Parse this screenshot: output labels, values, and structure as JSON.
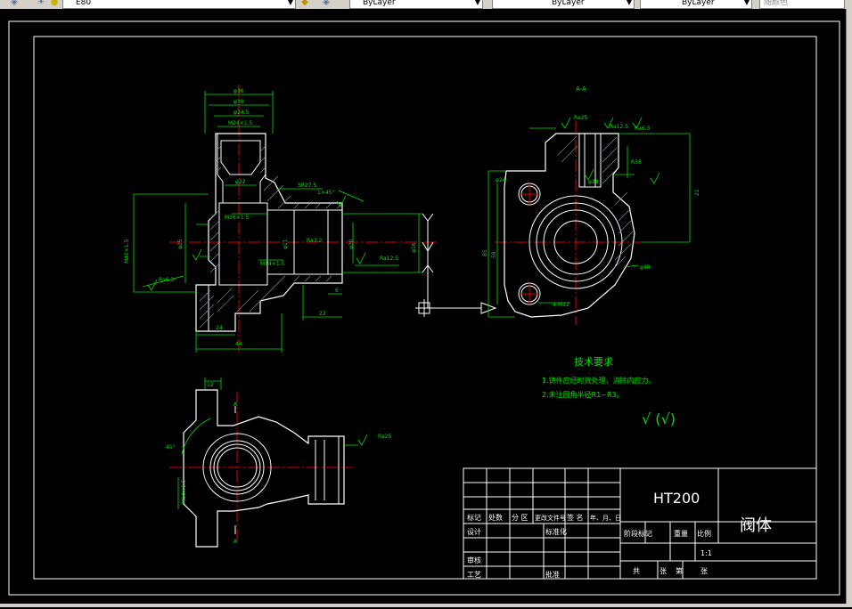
{
  "toolbar": {
    "layer_name": "E80",
    "color_value": "ByLayer",
    "linetype_value": "ByLayer",
    "lineweight_value": "ByLayer",
    "plotstyle_value": "随颜色"
  },
  "drawing": {
    "section_label": "A-A",
    "tech_title": "技术要求",
    "tech_items": [
      "1.铸件应经时效处理，消除内应力。",
      "2.未注圆角半径R1~R3。"
    ],
    "roughness_note": "√ (√)",
    "dims_front": [
      "φ36",
      "φ30",
      "φ24.5",
      "M24×1.5",
      "φ22",
      "SR27.5",
      "1×45°",
      "M36×1.5",
      "M40×1.5",
      "φ25",
      "M14×1.5",
      "φ11",
      "24",
      "44",
      "22",
      "6",
      "φ16",
      "Ra6.3",
      "Ra3.2",
      "Ra12.5",
      "φ20"
    ],
    "dims_side": [
      "Ra25",
      "Ra12.5",
      "Ra6.3",
      "φ24",
      "R38",
      "φ28",
      "φ48",
      "85",
      "58",
      "21",
      "4-M12"
    ],
    "dims_top": [
      "12",
      "45°",
      "M14×1.5",
      "Ra25",
      "A",
      "A"
    ]
  },
  "title_block": {
    "material": "HT200",
    "part_name": "阀体",
    "scale": "1:1",
    "row_marks": "标记",
    "row_count": "处数",
    "row_zone": "分 区",
    "row_doc": "更改文件号",
    "row_sign": "签 名",
    "row_date": "年、月、日",
    "design": "设计",
    "standardize": "标准化",
    "review": "审核",
    "process": "工艺",
    "approve": "批准",
    "stage_mark": "阶段标记",
    "weight": "重量",
    "scale_label": "比例",
    "total": "共",
    "sheet": "张",
    "page": "第",
    "sheet2": "张"
  }
}
